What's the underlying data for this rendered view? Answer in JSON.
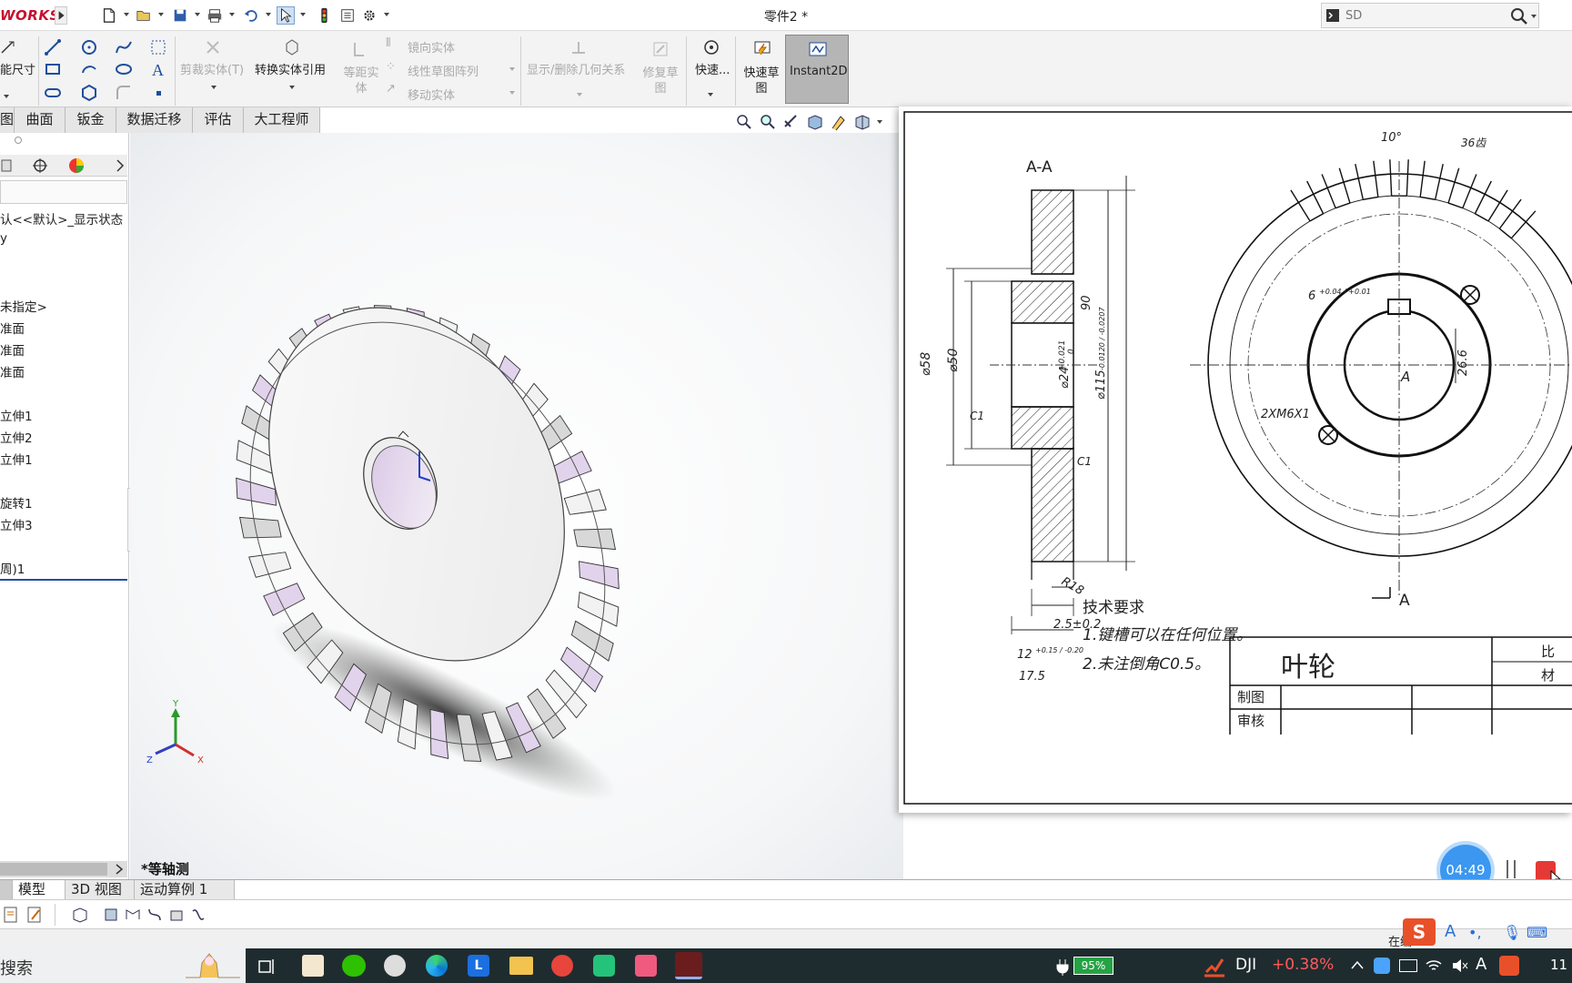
{
  "app": {
    "brand": "WORKS",
    "doc_title": "零件2 *",
    "search_placeholder": "SD"
  },
  "ribbon": {
    "smart_dim": "能尺寸",
    "trim": "剪裁实体(T)",
    "convert": "转换实体引用",
    "offset": "等距实\n体",
    "mirror": "镜向实体",
    "linear_pattern": "线性草图阵列",
    "move": "移动实体",
    "show_delete_rel": "显示/删除几何关系",
    "repair": "修复草\n图",
    "quick": "快速...",
    "quick_sketch": "快速草\n图",
    "instant2d": "Instant2D"
  },
  "tabs": [
    {
      "label": "图"
    },
    {
      "label": "曲面"
    },
    {
      "label": "钣金"
    },
    {
      "label": "数据迁移"
    },
    {
      "label": "评估"
    },
    {
      "label": "大工程师"
    }
  ],
  "tree": {
    "items": [
      "认<<默认>_显示状态",
      "y",
      "未指定>",
      "准面",
      "准面",
      "准面",
      "立伸1",
      "立伸2",
      "立伸1",
      "旋转1",
      "立伸3",
      "周)1"
    ]
  },
  "viewport": {
    "view_name": "*等轴测",
    "axis_x": "X",
    "axis_y": "Y",
    "axis_z": "Z"
  },
  "bottom_tabs": [
    {
      "label": "模型"
    },
    {
      "label": "3D 视图"
    },
    {
      "label": "运动算例 1"
    }
  ],
  "status": {
    "right_text": "在编"
  },
  "drawing": {
    "section_label": "A-A",
    "dims": {
      "d58": "⌀58",
      "d50": "⌀50",
      "d24": "⌀24",
      "d24_tol_upper": "+0.021",
      "d24_tol_lower": "0",
      "d115": "⌀115",
      "d115_tol": "-0.0120 / -0.0207",
      "h90": "90",
      "c1_left": "C1",
      "c1_right": "C1",
      "r18": "R18",
      "w25": "2.5±0.2",
      "w12": "12",
      "w12_tol": "+0.15 / -0.20",
      "w175": "17.5",
      "ang10": "10°",
      "teeth36": "36齿",
      "key6": "6",
      "key6_tol": "+0.04 / +0.01",
      "key266": "26.6",
      "holes": "2XM6X1",
      "label_a": "A",
      "arrow_a": "A"
    },
    "requirements_title": "技术要求",
    "requirement_1": "1.键槽可以在任何位置。",
    "requirement_2": "2.未注倒角C0.5。",
    "part_name": "叶轮",
    "title_block": {
      "drawn_by": "制图",
      "checked_by": "审核",
      "scale": "比",
      "material": "材"
    }
  },
  "recorder": {
    "timer": "04:49"
  },
  "taskbar": {
    "search": "搜索",
    "battery": "95%",
    "stock_name": "DJI",
    "stock_change": "+0.38%",
    "time": "11",
    "ime_a": "A"
  },
  "colors": {
    "accent_red": "#c8102e",
    "instant2d_bg": "#b5b5b5",
    "taskbar": "#1f2c2f",
    "stock_up": "#ff5a5a",
    "timer_blue": "#3b97f0"
  }
}
